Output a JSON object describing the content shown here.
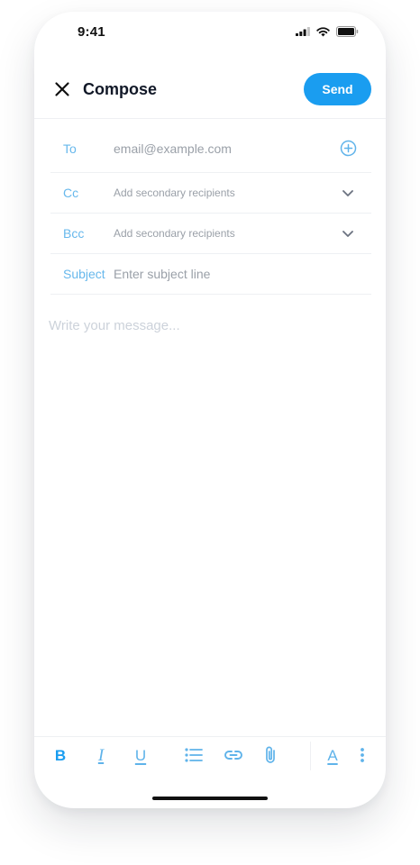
{
  "status_bar": {
    "time": "9:41"
  },
  "header": {
    "title": "Compose",
    "send_label": "Send",
    "close_icon": "close-icon"
  },
  "fields": {
    "to": {
      "label": "To",
      "placeholder": "email@example.com",
      "action_icon": "add-circle-icon"
    },
    "cc": {
      "label": "Cc",
      "placeholder": "Add secondary recipients",
      "action_icon": "chevron-down-icon"
    },
    "bcc": {
      "label": "Bcc",
      "placeholder": "Add secondary recipients",
      "action_icon": "chevron-down-icon"
    },
    "subject": {
      "label": "Subject",
      "placeholder": "Enter subject line"
    }
  },
  "body": {
    "placeholder": "Write your message..."
  },
  "toolbar": {
    "bold": "B",
    "italic": "I",
    "underline": "U",
    "text_color": "A",
    "icons": [
      "bold-icon",
      "italic-icon",
      "underline-icon",
      "list-icon",
      "link-icon",
      "attachment-icon",
      "text-color-icon",
      "more-vertical-icon"
    ]
  },
  "colors": {
    "accent": "#1a9df0",
    "label": "#67b8ec",
    "placeholder": "#9aa0a8"
  }
}
